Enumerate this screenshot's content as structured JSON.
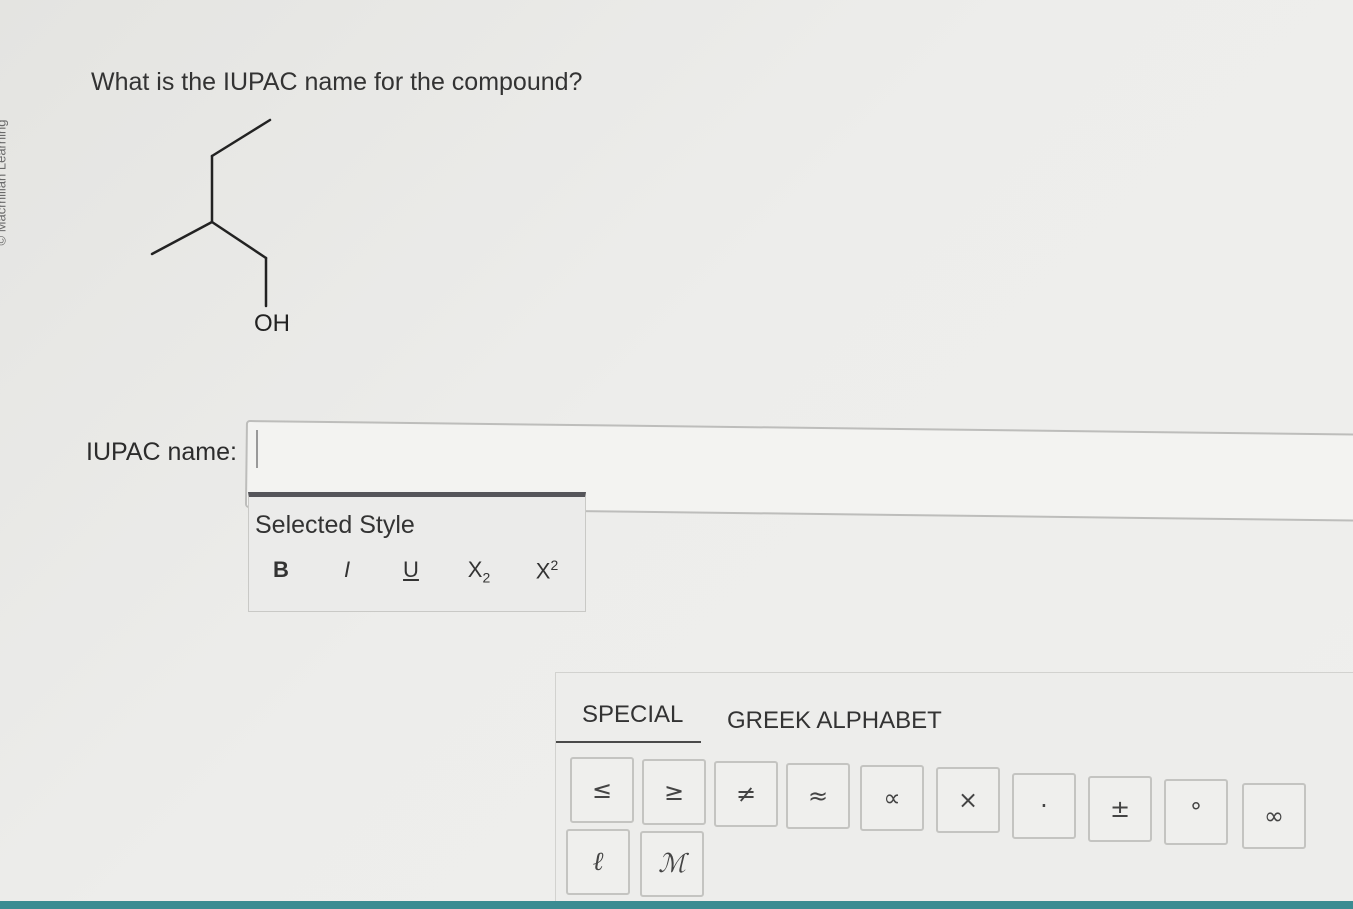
{
  "side_credit": "© Macmillan Learning",
  "question": {
    "text": "What is the IUPAC name for the compound?",
    "oh_label": "OH"
  },
  "answer": {
    "label": "IUPAC name:",
    "value": ""
  },
  "style_panel": {
    "title": "Selected Style",
    "bold": "B",
    "italic": "I",
    "underline": "U",
    "sub_base": "X",
    "sub_index": "2",
    "sup_base": "X",
    "sup_index": "2"
  },
  "char_panel": {
    "tabs": [
      "SPECIAL",
      "GREEK ALPHABET"
    ],
    "active_tab": "SPECIAL",
    "symbols": [
      "≤",
      "≥",
      "≠",
      "≈",
      "∝",
      "×",
      "·",
      "±",
      "°",
      "∞",
      "ℓ",
      "ℳ"
    ]
  }
}
